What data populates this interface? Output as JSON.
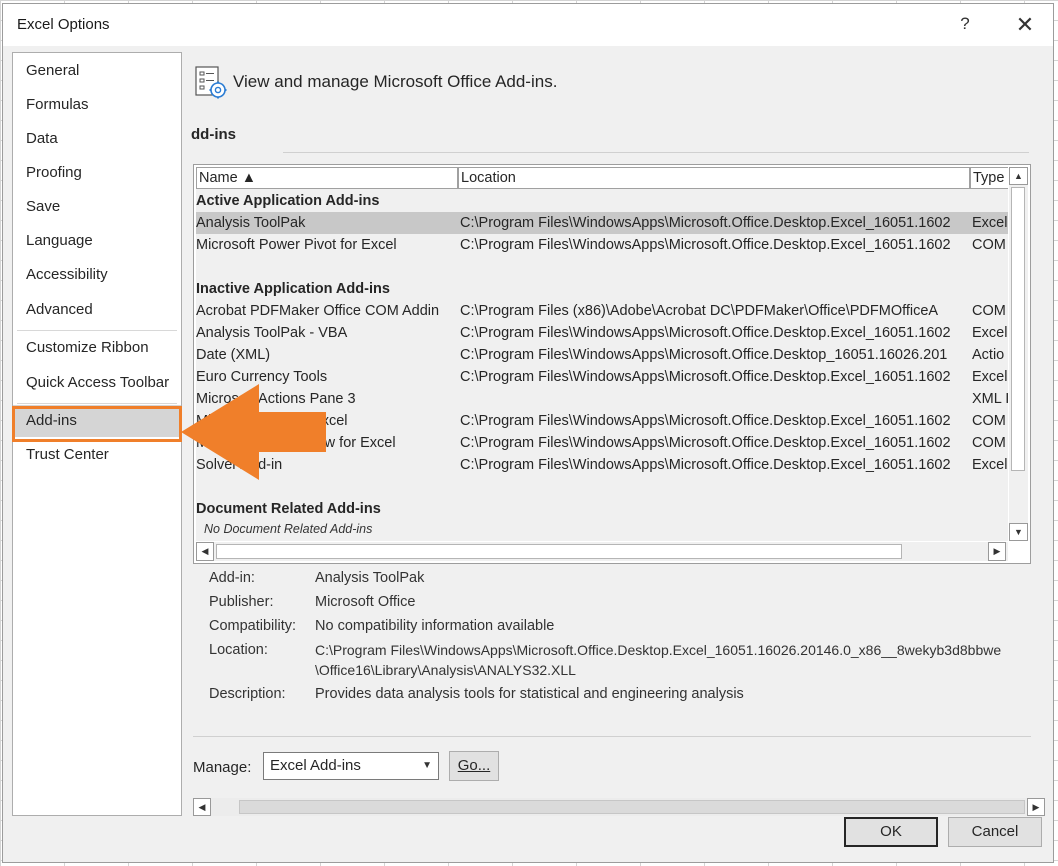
{
  "window": {
    "title": "Excel Options",
    "help_label": "?",
    "close_label": "✕"
  },
  "sidebar": {
    "items": [
      {
        "label": "General"
      },
      {
        "label": "Formulas"
      },
      {
        "label": "Data"
      },
      {
        "label": "Proofing"
      },
      {
        "label": "Save"
      },
      {
        "label": "Language"
      },
      {
        "label": "Accessibility"
      },
      {
        "label": "Advanced"
      },
      {
        "label": "Customize Ribbon"
      },
      {
        "label": "Quick Access Toolbar"
      },
      {
        "label": "Add-ins"
      },
      {
        "label": "Trust Center"
      }
    ],
    "selected": "Add-ins"
  },
  "annotation": {
    "arrow_color": "#f07f2a",
    "box_color": "#f07f2a"
  },
  "main": {
    "header": "View and manage Microsoft Office Add-ins.",
    "header_icon": "addins-settings-icon",
    "section_title": "dd-ins",
    "table": {
      "columns": [
        "Name ▲",
        "Location",
        "Type"
      ],
      "groups": [
        {
          "title": "Active Application Add-ins",
          "rows": [
            {
              "name": "Analysis ToolPak",
              "location": "C:\\Program Files\\WindowsApps\\Microsoft.Office.Desktop.Excel_16051.1602",
              "type": "Excel"
            },
            {
              "name": "Microsoft Power Pivot for Excel",
              "location": "C:\\Program Files\\WindowsApps\\Microsoft.Office.Desktop.Excel_16051.1602",
              "type": "COM"
            }
          ]
        },
        {
          "title": "Inactive Application Add-ins",
          "rows": [
            {
              "name": "Acrobat PDFMaker Office COM Addin",
              "location": "C:\\Program Files (x86)\\Adobe\\Acrobat DC\\PDFMaker\\Office\\PDFMOfficeA",
              "type": "COM"
            },
            {
              "name": "Analysis ToolPak - VBA",
              "location": "C:\\Program Files\\WindowsApps\\Microsoft.Office.Desktop.Excel_16051.1602",
              "type": "Excel"
            },
            {
              "name": "Date (XML)",
              "location": "C:\\Program Files\\WindowsApps\\Microsoft.Office.Desktop_16051.16026.201",
              "type": "Actio"
            },
            {
              "name": "Euro Currency Tools",
              "location": "C:\\Program Files\\WindowsApps\\Microsoft.Office.Desktop.Excel_16051.1602",
              "type": "Excel"
            },
            {
              "name": "Microsoft Actions Pane 3",
              "location": "",
              "type": "XML I"
            },
            {
              "name": "Microsoft Map for Excel",
              "location": "C:\\Program Files\\WindowsApps\\Microsoft.Office.Desktop.Excel_16051.1602",
              "type": "COM"
            },
            {
              "name": "Microsoft Power View for Excel",
              "location": "C:\\Program Files\\WindowsApps\\Microsoft.Office.Desktop.Excel_16051.1602",
              "type": "COM"
            },
            {
              "name": "Solver Add-in",
              "location": "C:\\Program Files\\WindowsApps\\Microsoft.Office.Desktop.Excel_16051.1602",
              "type": "Excel"
            }
          ]
        },
        {
          "title": "Document Related Add-ins",
          "empty_note": "No Document Related Add-ins"
        }
      ]
    },
    "details": {
      "addin_label": "Add-in:",
      "addin_value": "Analysis ToolPak",
      "publisher_label": "Publisher:",
      "publisher_value": "Microsoft Office",
      "compat_label": "Compatibility:",
      "compat_value": "No compatibility information available",
      "location_label": "Location:",
      "location_value_1": "C:\\Program Files\\WindowsApps\\Microsoft.Office.Desktop.Excel_16051.16026.20146.0_x86__8wekyb3d8bbwe",
      "location_value_2": "\\Office16\\Library\\Analysis\\ANALYS32.XLL",
      "description_label": "Description:",
      "description_value": "Provides data analysis tools for statistical and engineering analysis"
    },
    "manage": {
      "label": "Manage:",
      "selected": "Excel Add-ins",
      "go_label": "Go..."
    }
  },
  "footer": {
    "ok_label": "OK",
    "cancel_label": "Cancel"
  }
}
